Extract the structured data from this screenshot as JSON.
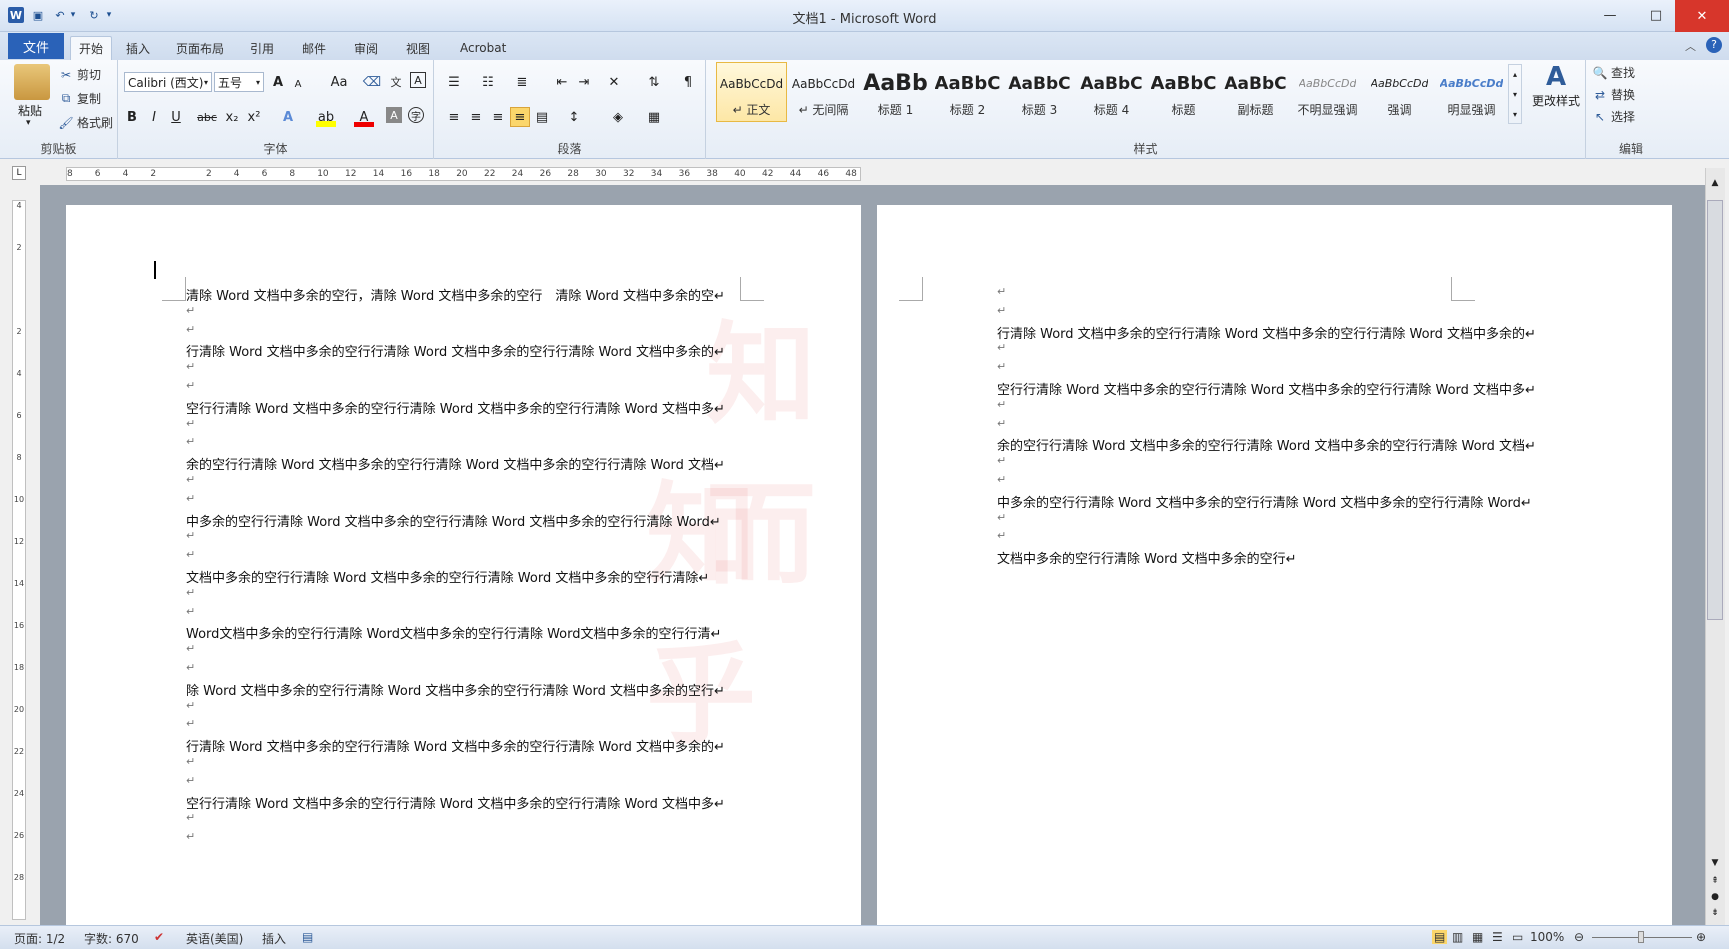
{
  "window": {
    "title": "文档1 - Microsoft Word",
    "minimize": "—",
    "maximize": "□",
    "close": "✕"
  },
  "qat": {
    "app_icon": "W",
    "save": "💾",
    "undo": "↶",
    "redo": "↻",
    "customize": "▾"
  },
  "tabs": [
    "开始",
    "插入",
    "页面布局",
    "引用",
    "邮件",
    "审阅",
    "视图",
    "Acrobat"
  ],
  "file_tab": "文件",
  "clipboard": {
    "paste": "粘贴",
    "cut": "剪切",
    "copy": "复制",
    "format_painter": "格式刷",
    "label": "剪贴板"
  },
  "font": {
    "name": "Calibri (西文)",
    "size": "五号",
    "label": "字体",
    "bold": "B",
    "italic": "I",
    "underline": "U",
    "strike": "abc",
    "sub": "x₂",
    "sup": "x²",
    "grow": "A",
    "shrink": "A",
    "case": "Aa"
  },
  "paragraph": {
    "label": "段落"
  },
  "styles": {
    "label": "样式",
    "items": [
      {
        "preview": "AaBbCcDd",
        "name": "↵ 正文"
      },
      {
        "preview": "AaBbCcDd",
        "name": "↵ 无间隔"
      },
      {
        "preview": "AaBb",
        "name": "标题 1"
      },
      {
        "preview": "AaBbC",
        "name": "标题 2"
      },
      {
        "preview": "AaBbC",
        "name": "标题 3"
      },
      {
        "preview": "AaBbC",
        "name": "标题 4"
      },
      {
        "preview": "AaBbC",
        "name": "标题"
      },
      {
        "preview": "AaBbC",
        "name": "副标题"
      },
      {
        "preview": "AaBbCcDd",
        "name": "不明显强调"
      },
      {
        "preview": "AaBbCcDd",
        "name": "强调"
      },
      {
        "preview": "AaBbCcDd",
        "name": "明显强调"
      }
    ],
    "change": "更改样式"
  },
  "editing": {
    "label": "编辑",
    "find": "查找",
    "replace": "替换",
    "select": "选择"
  },
  "page1_lines": [
    "清除 Word 文档中多余的空行，清除 Word 文档中多余的空行　清除 Word 文档中多余的空↵",
    "↵",
    "↵",
    "行清除 Word 文档中多余的空行行清除 Word 文档中多余的空行行清除 Word 文档中多余的↵",
    "↵",
    "↵",
    "空行行清除 Word 文档中多余的空行行清除 Word 文档中多余的空行行清除 Word 文档中多↵",
    "↵",
    "↵",
    "余的空行行清除 Word 文档中多余的空行行清除 Word 文档中多余的空行行清除 Word 文档↵",
    "↵",
    "↵",
    "中多余的空行行清除 Word 文档中多余的空行行清除 Word 文档中多余的空行行清除 Word↵",
    "↵",
    "↵",
    "文档中多余的空行行清除 Word 文档中多余的空行行清除 Word 文档中多余的空行行清除↵",
    "↵",
    "↵",
    "Word文档中多余的空行行清除 Word文档中多余的空行行清除 Word文档中多余的空行行清↵",
    "↵",
    "↵",
    "除 Word 文档中多余的空行行清除 Word 文档中多余的空行行清除 Word 文档中多余的空行↵",
    "↵",
    "↵",
    "行清除 Word 文档中多余的空行行清除 Word 文档中多余的空行行清除 Word 文档中多余的↵",
    "↵",
    "↵",
    "空行行清除 Word 文档中多余的空行行清除 Word 文档中多余的空行行清除 Word 文档中多↵",
    "↵",
    "↵"
  ],
  "page2_lines": [
    "↵",
    "↵",
    "行清除 Word 文档中多余的空行行清除 Word 文档中多余的空行行清除 Word 文档中多余的↵",
    "↵",
    "↵",
    "空行行清除 Word 文档中多余的空行行清除 Word 文档中多余的空行行清除 Word 文档中多↵",
    "↵",
    "↵",
    "余的空行行清除 Word 文档中多余的空行行清除 Word 文档中多余的空行行清除 Word 文档↵",
    "↵",
    "↵",
    "中多余的空行行清除 Word 文档中多余的空行行清除 Word 文档中多余的空行行清除 Word↵",
    "↵",
    "↵",
    "文档中多余的空行行清除 Word 文档中多余的空行↵"
  ],
  "ruler_ticks": [
    "8",
    "6",
    "4",
    "2",
    "",
    "2",
    "4",
    "6",
    "8",
    "10",
    "12",
    "14",
    "16",
    "18",
    "20",
    "22",
    "24",
    "26",
    "28",
    "30",
    "32",
    "34",
    "36",
    "38",
    "40",
    "42",
    "44",
    "46",
    "48"
  ],
  "vruler_ticks": [
    "4",
    "2",
    "",
    "2",
    "4",
    "6",
    "8",
    "10",
    "12",
    "14",
    "16",
    "18",
    "20",
    "22",
    "24",
    "26",
    "28"
  ],
  "watermark": {
    "top": "知 而",
    "bottom": "知 乎"
  },
  "status": {
    "page": "页面: 1/2",
    "words": "字数: 670",
    "language": "英语(美国)",
    "mode": "插入",
    "zoom": "100%"
  }
}
